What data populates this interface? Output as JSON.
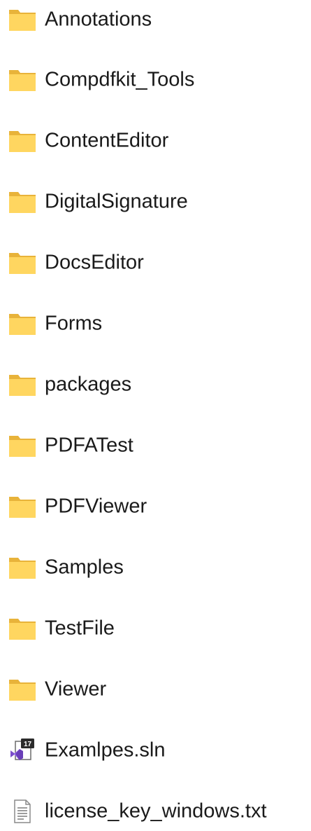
{
  "items": [
    {
      "label": "Annotations",
      "icon": "folder-icon"
    },
    {
      "label": "Compdfkit_Tools",
      "icon": "folder-icon"
    },
    {
      "label": "ContentEditor",
      "icon": "folder-icon"
    },
    {
      "label": "DigitalSignature",
      "icon": "folder-icon"
    },
    {
      "label": "DocsEditor",
      "icon": "folder-icon"
    },
    {
      "label": "Forms",
      "icon": "folder-icon"
    },
    {
      "label": "packages",
      "icon": "folder-icon"
    },
    {
      "label": "PDFATest",
      "icon": "folder-icon"
    },
    {
      "label": "PDFViewer",
      "icon": "folder-icon"
    },
    {
      "label": "Samples",
      "icon": "folder-icon"
    },
    {
      "label": "TestFile",
      "icon": "folder-icon"
    },
    {
      "label": "Viewer",
      "icon": "folder-icon"
    },
    {
      "label": "Examlpes.sln",
      "icon": "visual-studio-solution-icon",
      "badge": "17"
    },
    {
      "label": "license_key_windows.txt",
      "icon": "text-file-icon"
    }
  ],
  "colors": {
    "folder_back": "#e8b33a",
    "folder_front": "#ffd660",
    "text": "#1a1a1a",
    "vs_purple": "#7b4fc9"
  }
}
